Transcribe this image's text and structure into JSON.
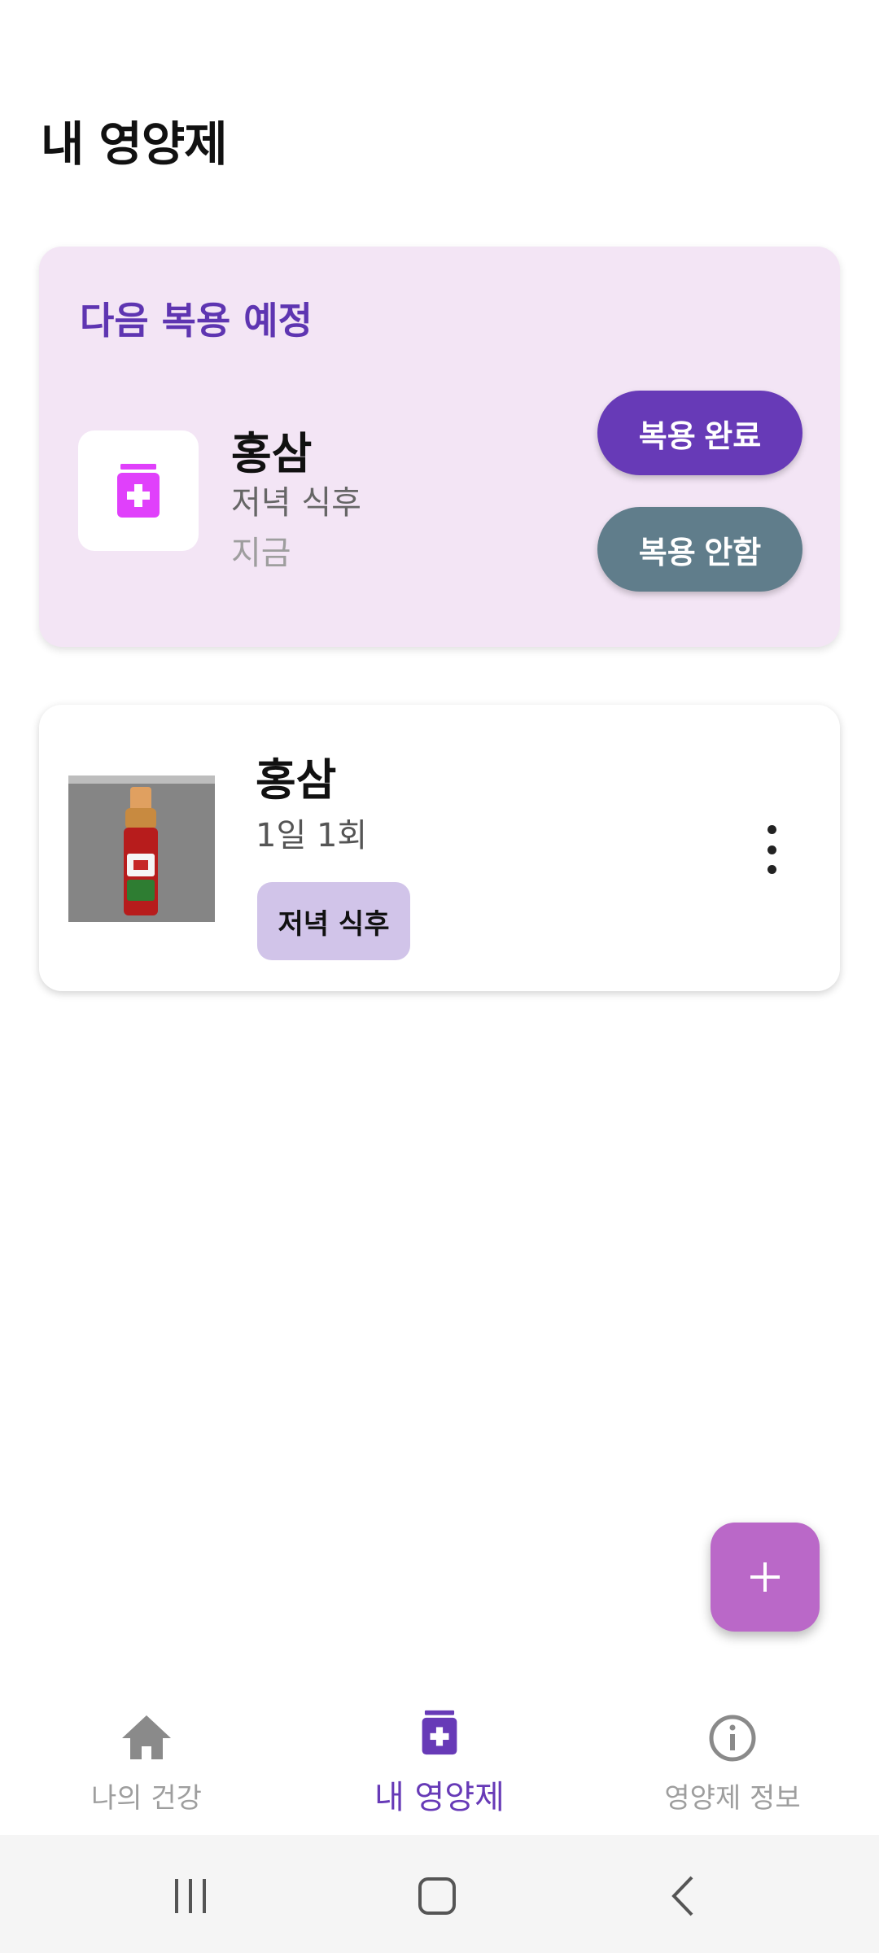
{
  "header": {
    "title": "내 영양제"
  },
  "next_dose": {
    "heading": "다음 복용 예정",
    "icon": "pill-bottle-icon",
    "name": "홍삼",
    "timing": "저녁 식후",
    "when": "지금",
    "done_label": "복용 완료",
    "skip_label": "복용 안함"
  },
  "supplements": [
    {
      "name": "홍삼",
      "frequency": "1일 1회",
      "tag": "저녁 식후"
    }
  ],
  "bottom_nav": {
    "items": [
      {
        "label": "나의 건강",
        "icon": "home-icon",
        "active": false
      },
      {
        "label": "내 영양제",
        "icon": "pill-bottle-icon",
        "active": true
      },
      {
        "label": "영양제 정보",
        "icon": "info-icon",
        "active": false
      }
    ]
  },
  "colors": {
    "primary": "#673ab7",
    "card_bg": "#f3e5f5",
    "skip_button": "#607d8b",
    "chip_bg": "#d1c4e9",
    "fab": "#ba68c8",
    "accent_icon": "#e040fb"
  }
}
